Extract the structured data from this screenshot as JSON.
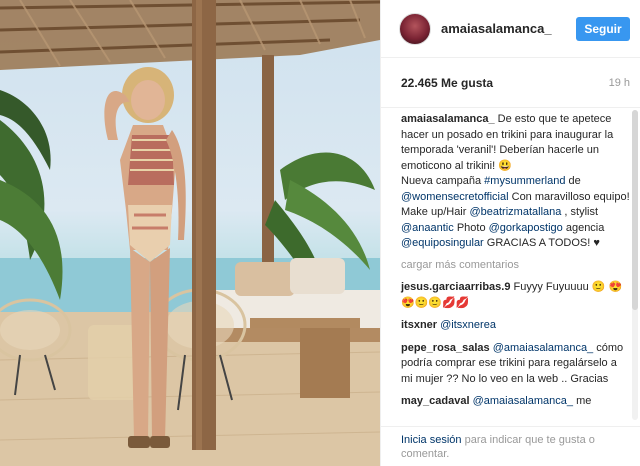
{
  "post": {
    "username": "amaiasalamanca_",
    "follow_label": "Seguir",
    "likes": "22.465 Me gusta",
    "time": "19 h"
  },
  "caption": {
    "user": "amaiasalamanca_",
    "text1": " De esto que te apetece hacer un posado en trikini para inaugurar la temporada 'veranil'! Deberían hacerle un emoticono al trikini! 😃",
    "text2": "Nueva campaña ",
    "tag1": "#mysummerland",
    "text3": " de ",
    "mention1": "@womensecretofficial",
    "text4": " Con maravilloso equipo! Make up/Hair ",
    "mention2": "@beatrizmatallana",
    "text5": " , stylist ",
    "mention3": "@anaantic",
    "text6": " Photo ",
    "mention4": "@gorkapostigo",
    "text7": " agencia ",
    "mention5": "@equiposingular",
    "text8": " GRACIAS A TODOS! ♥"
  },
  "load_more": "cargar más comentarios",
  "comments": [
    {
      "user": "jesus.garciaarribas.9",
      "mention": "",
      "text": " Fuyyy Fuyuuuu 🙂 😍😍🙂🙂💋💋"
    },
    {
      "user": "itsxner",
      "mention": "@itsxnerea",
      "text": ""
    },
    {
      "user": "pepe_rosa_salas",
      "mention": "@amaiasalamanca_",
      "text": " cómo podría comprar ese trikini para regalárselo a mi mujer ?? No lo veo en la web .. Gracias"
    },
    {
      "user": "may_cadaval",
      "mention": "@amaiasalamanca_",
      "text": " me"
    }
  ],
  "footer": {
    "login": "Inicia sesión",
    "rest": " para indicar que te gusta o comentar."
  },
  "colors": {
    "accent": "#3897f0",
    "link": "#003569",
    "muted": "#999999"
  }
}
